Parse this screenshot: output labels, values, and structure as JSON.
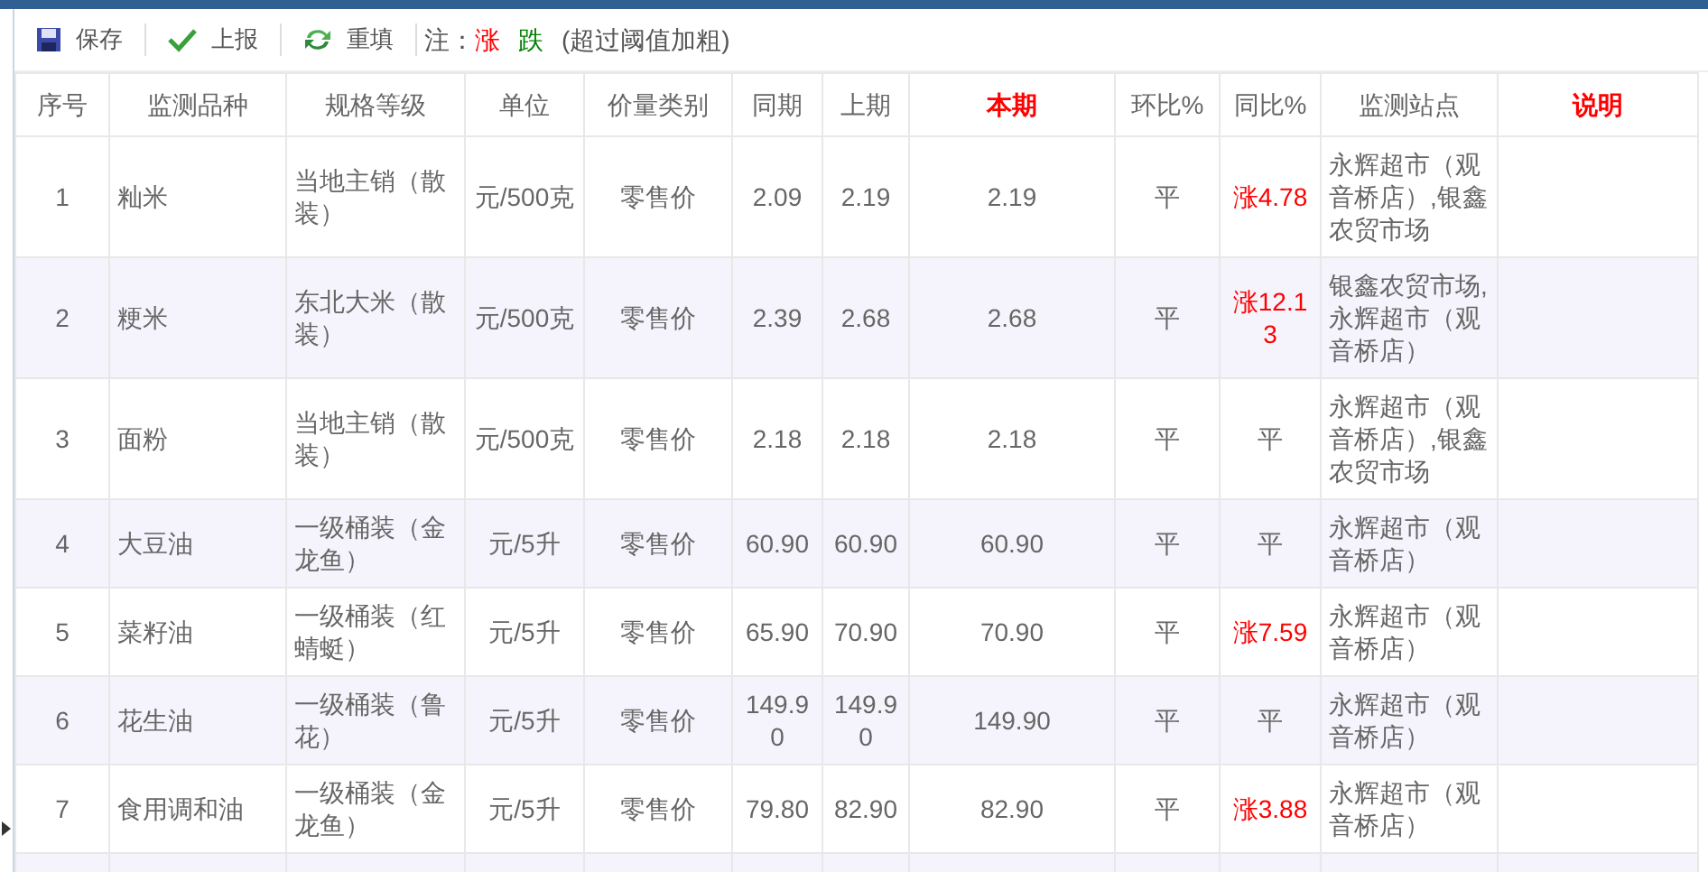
{
  "toolbar": {
    "buttons": [
      {
        "kind": "save",
        "label": "保存"
      },
      {
        "kind": "submit",
        "label": "上报"
      },
      {
        "kind": "reset",
        "label": "重填"
      }
    ],
    "note_label": "注：",
    "legend": [
      {
        "text": "涨",
        "color": "#ff0000"
      },
      {
        "text": "跌",
        "color": "#008000"
      }
    ],
    "note": "(超过阈值加粗)"
  },
  "table": {
    "columns": [
      {
        "label": "序号",
        "emphasis": false
      },
      {
        "label": "监测品种",
        "emphasis": false
      },
      {
        "label": "规格等级",
        "emphasis": false
      },
      {
        "label": "单位",
        "emphasis": false
      },
      {
        "label": "价量类别",
        "emphasis": false
      },
      {
        "label": "同期",
        "emphasis": false
      },
      {
        "label": "上期",
        "emphasis": false
      },
      {
        "label": "本期",
        "emphasis": true
      },
      {
        "label": "环比%",
        "emphasis": false
      },
      {
        "label": "同比%",
        "emphasis": false
      },
      {
        "label": "监测站点",
        "emphasis": false
      },
      {
        "label": "说明",
        "emphasis": true
      }
    ],
    "rows": [
      {
        "no": "1",
        "item": "籼米",
        "grade": "当地主销（散装）",
        "unit": "元/500克",
        "price_type": "零售价",
        "same_period": "2.09",
        "last_period": "2.19",
        "current": "2.19",
        "mom": {
          "kind": "flat",
          "text": "平"
        },
        "yoy": {
          "kind": "up",
          "text": "涨4.78"
        },
        "stations": "永辉超市（观音桥店）,银鑫农贸市场"
      },
      {
        "no": "2",
        "item": "粳米",
        "grade": "东北大米（散装）",
        "unit": "元/500克",
        "price_type": "零售价",
        "same_period": "2.39",
        "last_period": "2.68",
        "current": "2.68",
        "mom": {
          "kind": "flat",
          "text": "平"
        },
        "yoy": {
          "kind": "up",
          "text": "涨12.13"
        },
        "stations": "银鑫农贸市场,永辉超市（观音桥店）"
      },
      {
        "no": "3",
        "item": "面粉",
        "grade": "当地主销（散装）",
        "unit": "元/500克",
        "price_type": "零售价",
        "same_period": "2.18",
        "last_period": "2.18",
        "current": "2.18",
        "mom": {
          "kind": "flat",
          "text": "平"
        },
        "yoy": {
          "kind": "flat",
          "text": "平"
        },
        "stations": "永辉超市（观音桥店）,银鑫农贸市场"
      },
      {
        "no": "4",
        "item": "大豆油",
        "grade": "一级桶装（金龙鱼）",
        "unit": "元/5升",
        "price_type": "零售价",
        "same_period": "60.90",
        "last_period": "60.90",
        "current": "60.90",
        "mom": {
          "kind": "flat",
          "text": "平"
        },
        "yoy": {
          "kind": "flat",
          "text": "平"
        },
        "stations": "永辉超市（观音桥店）"
      },
      {
        "no": "5",
        "item": "菜籽油",
        "grade": "一级桶装（红蜻蜓）",
        "unit": "元/5升",
        "price_type": "零售价",
        "same_period": "65.90",
        "last_period": "70.90",
        "current": "70.90",
        "mom": {
          "kind": "flat",
          "text": "平"
        },
        "yoy": {
          "kind": "up",
          "text": "涨7.59"
        },
        "stations": "永辉超市（观音桥店）"
      },
      {
        "no": "6",
        "item": "花生油",
        "grade": "一级桶装（鲁花）",
        "unit": "元/5升",
        "price_type": "零售价",
        "same_period": "149.90",
        "last_period": "149.90",
        "current": "149.90",
        "mom": {
          "kind": "flat",
          "text": "平"
        },
        "yoy": {
          "kind": "flat",
          "text": "平"
        },
        "stations": "永辉超市（观音桥店）"
      },
      {
        "no": "7",
        "item": "食用调和油",
        "grade": "一级桶装（金龙鱼）",
        "unit": "元/5升",
        "price_type": "零售价",
        "same_period": "79.80",
        "last_period": "82.90",
        "current": "82.90",
        "mom": {
          "kind": "flat",
          "text": "平"
        },
        "yoy": {
          "kind": "up",
          "text": "涨3.88"
        },
        "stations": "永辉超市（观音桥店）"
      }
    ]
  }
}
